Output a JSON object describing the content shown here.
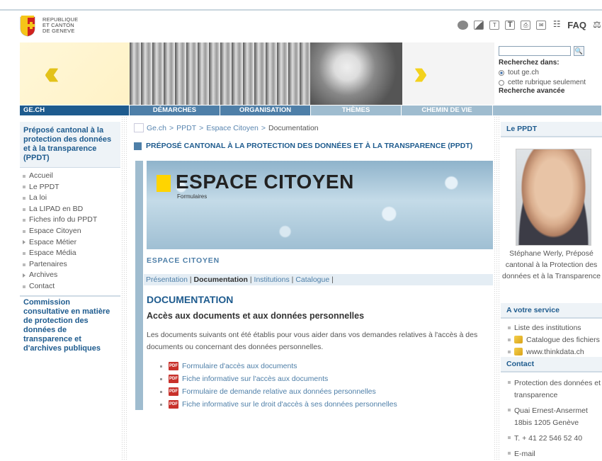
{
  "header": {
    "logo_lines": [
      "REPUBLIQUE",
      "ET CANTON",
      "DE GENEVE"
    ],
    "tools": {
      "faq_label": "FAQ",
      "icons": [
        "rss-icon",
        "print-page-icon",
        "text-small-icon",
        "text-large-icon",
        "printer-icon",
        "email-icon",
        "sitemap-icon",
        "balance-icon"
      ]
    }
  },
  "search": {
    "button_icon": "search-icon",
    "label": "Recherchez dans:",
    "options": [
      "tout ge.ch",
      "cette rubrique seulement"
    ],
    "selected": "tout ge.ch",
    "advanced": "Recherche avancée"
  },
  "nav": {
    "home": "GE.CH",
    "items": [
      "DÉMARCHES",
      "ORGANISATION",
      "THÈMES",
      "CHEMIN DE VIE"
    ]
  },
  "sidebar": {
    "title": "Préposé cantonal à la protection des données et à la transparence (PPDT)",
    "items": [
      {
        "label": "Accueil",
        "arrow": false
      },
      {
        "label": "Le PPDT",
        "arrow": false
      },
      {
        "label": "La loi",
        "arrow": false
      },
      {
        "label": "La LIPAD en BD",
        "arrow": false
      },
      {
        "label": "Fiches info du PPDT",
        "arrow": false
      },
      {
        "label": "Espace Citoyen",
        "arrow": false
      },
      {
        "label": "Espace Métier",
        "arrow": true
      },
      {
        "label": "Espace Média",
        "arrow": false
      },
      {
        "label": "Partenaires",
        "arrow": false
      },
      {
        "label": "Archives",
        "arrow": true
      },
      {
        "label": "Contact",
        "arrow": false
      }
    ],
    "title2": "Commission consultative en matière de protection des données de transparence et d'archives publiques"
  },
  "breadcrumb": {
    "items": [
      "Ge.ch",
      "PPDT",
      "Espace Citoyen"
    ],
    "current": "Documentation"
  },
  "main": {
    "page_title": "PRÉPOSÉ CANTONAL À LA PROTECTION DES DONNÉES ET À LA TRANSPARENCE (PPDT)",
    "hero_title": "ESPACE CITOYEN",
    "hero_sub": "Formulaires",
    "section": "ESPACE CITOYEN",
    "subnav": {
      "items": [
        "Présentation",
        "Documentation",
        "Institutions",
        "Catalogue"
      ],
      "active": "Documentation"
    },
    "doc_heading": "DOCUMENTATION",
    "doc_subheading": "Accès aux documents et aux données personnelles",
    "doc_text": "Les documents suivants ont été établis pour vous aider dans vos demandes relatives à l'accès à des documents ou concernant des données personnelles.",
    "docs": [
      "Formulaire d'accès aux documents",
      "Fiche informative sur l'accès aux documents",
      "Formulaire de demande relative aux données personnelles",
      "Fiche informative sur le droit d'accès à ses données personnelles"
    ],
    "pdf_label": "PDF"
  },
  "right": {
    "ppdt_head": "Le PPDT",
    "caption": "Stéphane Werly, Préposé cantonal à la Protection des données et à la Transparence",
    "service_head": "A votre service",
    "services": [
      "Liste des institutions",
      "Catalogue des fichiers",
      "www.thinkdata.ch"
    ],
    "contact_head": "Contact",
    "contact": [
      "Protection des données et transparence",
      "Quai Ernest-Ansermet 18bis 1205 Genève",
      "T. + 41 22 546 52 40",
      "E-mail"
    ]
  },
  "colors": {
    "accent_dark": "#1e5b8e",
    "accent_mid": "#4e7fa8",
    "accent_light": "#9fbccf"
  }
}
